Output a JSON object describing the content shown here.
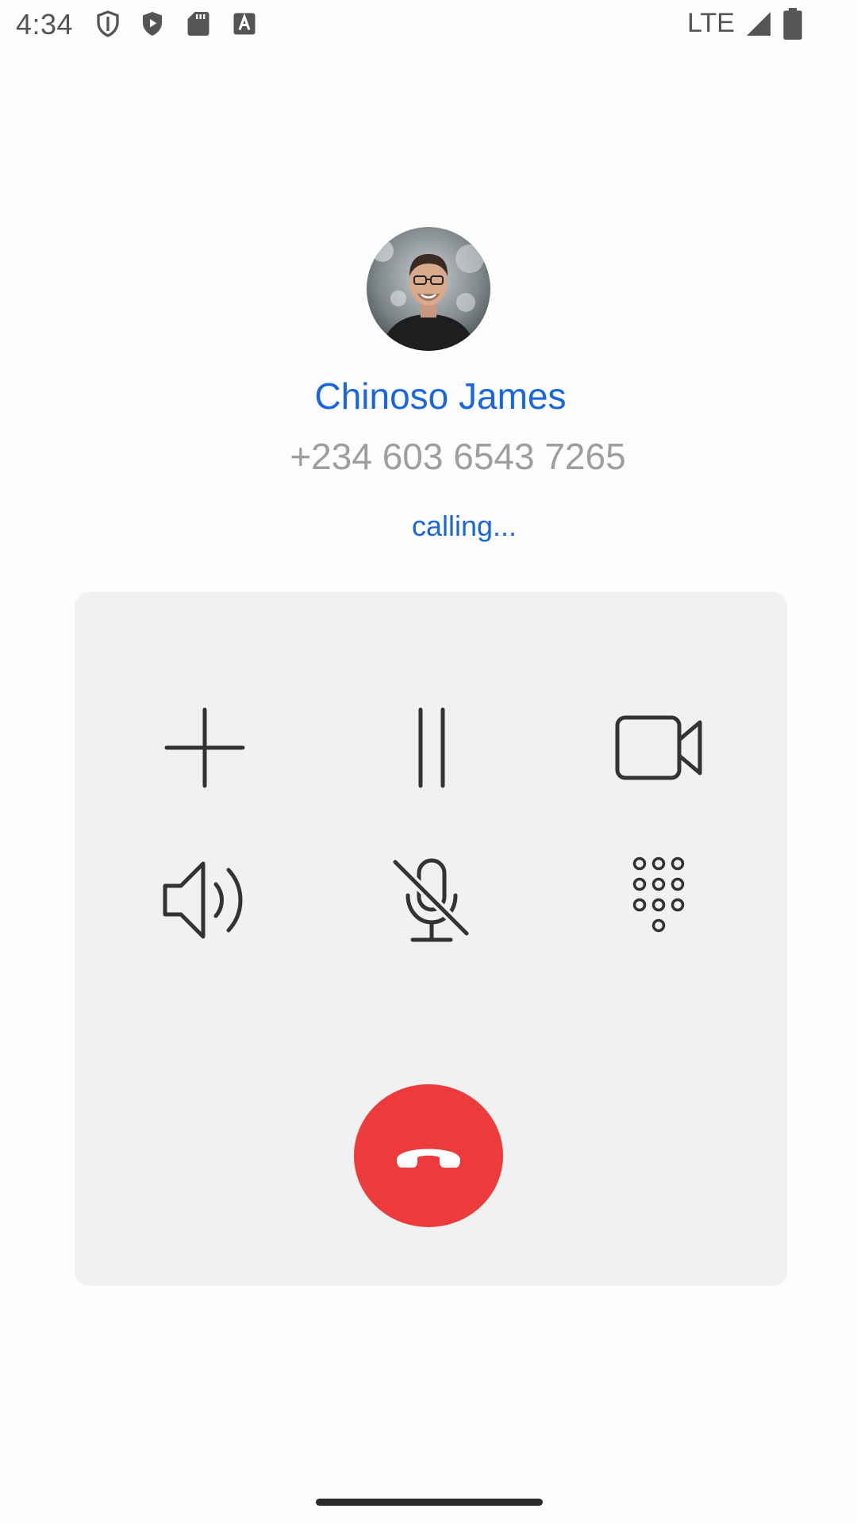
{
  "status_bar": {
    "time": "4:34",
    "network": "LTE",
    "icons": [
      "vpn-shield-icon",
      "play-protect-icon",
      "sd-card-icon",
      "text-a-icon",
      "signal-icon",
      "battery-icon"
    ]
  },
  "contact": {
    "name": "Chinoso James",
    "number": "+234 603 6543 7265",
    "status": "calling...",
    "avatar": "contact-photo"
  },
  "controls": [
    {
      "icon": "add-call-icon"
    },
    {
      "icon": "hold-icon"
    },
    {
      "icon": "video-call-icon"
    },
    {
      "icon": "speaker-icon"
    },
    {
      "icon": "mute-icon"
    },
    {
      "icon": "dialpad-icon"
    }
  ],
  "end_call": {
    "icon": "end-call-icon"
  },
  "colors": {
    "accent": "#1a66e0",
    "secondary_text": "#9e9e9e",
    "panel_bg": "#f1f1f1",
    "end_call": "#ed3a3a",
    "icon": "#333333"
  }
}
